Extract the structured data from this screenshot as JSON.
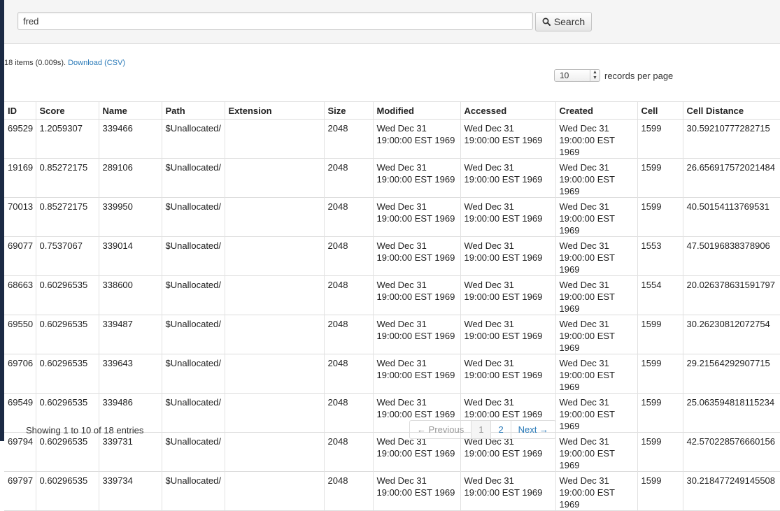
{
  "search": {
    "value": "fred",
    "button_label": "Search"
  },
  "summary": {
    "text": "18 items (0.009s). ",
    "download_label": "Download (CSV)"
  },
  "page_size": {
    "selected": "10",
    "label": "records per page"
  },
  "table": {
    "columns": [
      "ID",
      "Score",
      "Name",
      "Path",
      "Extension",
      "Size",
      "Modified",
      "Accessed",
      "Created",
      "Cell",
      "Cell Distance"
    ],
    "rows": [
      [
        "69529",
        "1.2059307",
        "339466",
        "$Unallocated/",
        "",
        "2048",
        "Wed Dec 31 19:00:00 EST 1969",
        "Wed Dec 31 19:00:00 EST 1969",
        "Wed Dec 31 19:00:00 EST 1969",
        "1599",
        "30.59210777282715"
      ],
      [
        "19169",
        "0.85272175",
        "289106",
        "$Unallocated/",
        "",
        "2048",
        "Wed Dec 31 19:00:00 EST 1969",
        "Wed Dec 31 19:00:00 EST 1969",
        "Wed Dec 31 19:00:00 EST 1969",
        "1599",
        "26.656917572021484"
      ],
      [
        "70013",
        "0.85272175",
        "339950",
        "$Unallocated/",
        "",
        "2048",
        "Wed Dec 31 19:00:00 EST 1969",
        "Wed Dec 31 19:00:00 EST 1969",
        "Wed Dec 31 19:00:00 EST 1969",
        "1599",
        "40.50154113769531"
      ],
      [
        "69077",
        "0.7537067",
        "339014",
        "$Unallocated/",
        "",
        "2048",
        "Wed Dec 31 19:00:00 EST 1969",
        "Wed Dec 31 19:00:00 EST 1969",
        "Wed Dec 31 19:00:00 EST 1969",
        "1553",
        "47.50196838378906"
      ],
      [
        "68663",
        "0.60296535",
        "338600",
        "$Unallocated/",
        "",
        "2048",
        "Wed Dec 31 19:00:00 EST 1969",
        "Wed Dec 31 19:00:00 EST 1969",
        "Wed Dec 31 19:00:00 EST 1969",
        "1554",
        "20.026378631591797"
      ],
      [
        "69550",
        "0.60296535",
        "339487",
        "$Unallocated/",
        "",
        "2048",
        "Wed Dec 31 19:00:00 EST 1969",
        "Wed Dec 31 19:00:00 EST 1969",
        "Wed Dec 31 19:00:00 EST 1969",
        "1599",
        "30.26230812072754"
      ],
      [
        "69706",
        "0.60296535",
        "339643",
        "$Unallocated/",
        "",
        "2048",
        "Wed Dec 31 19:00:00 EST 1969",
        "Wed Dec 31 19:00:00 EST 1969",
        "Wed Dec 31 19:00:00 EST 1969",
        "1599",
        "29.21564292907715"
      ],
      [
        "69549",
        "0.60296535",
        "339486",
        "$Unallocated/",
        "",
        "2048",
        "Wed Dec 31 19:00:00 EST 1969",
        "Wed Dec 31 19:00:00 EST 1969",
        "Wed Dec 31 19:00:00 EST 1969",
        "1599",
        "25.063594818115234"
      ],
      [
        "69794",
        "0.60296535",
        "339731",
        "$Unallocated/",
        "",
        "2048",
        "Wed Dec 31 19:00:00 EST 1969",
        "Wed Dec 31 19:00:00 EST 1969",
        "Wed Dec 31 19:00:00 EST 1969",
        "1599",
        "42.570228576660156"
      ],
      [
        "69797",
        "0.60296535",
        "339734",
        "$Unallocated/",
        "",
        "2048",
        "Wed Dec 31 19:00:00 EST 1969",
        "Wed Dec 31 19:00:00 EST 1969",
        "Wed Dec 31 19:00:00 EST 1969",
        "1599",
        "30.218477249145508"
      ]
    ]
  },
  "footer": {
    "info": "Showing 1 to 10 of 18 entries",
    "prev_label": "← Previous",
    "pages": [
      "1",
      "2"
    ],
    "next_label": "Next →"
  }
}
